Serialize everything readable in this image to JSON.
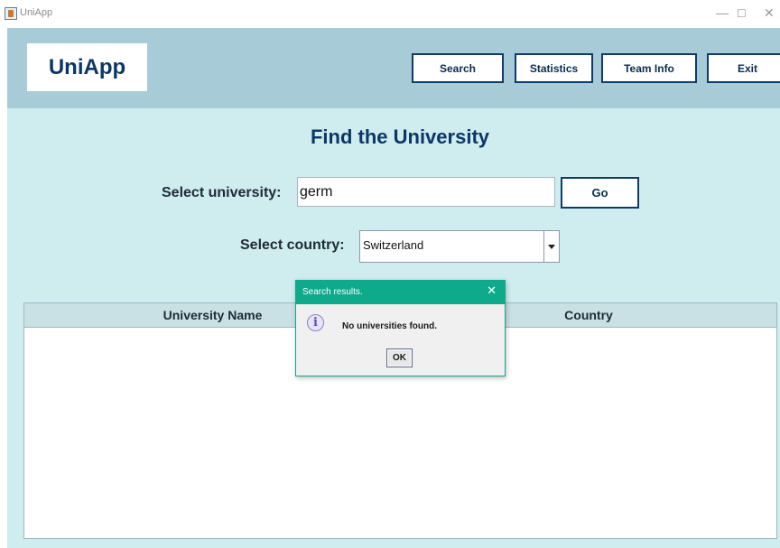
{
  "window": {
    "title": "UniApp"
  },
  "header": {
    "logo": "UniApp",
    "nav": {
      "search": "Search",
      "statistics": "Statistics",
      "team_info": "Team Info",
      "exit": "Exit"
    }
  },
  "main": {
    "title": "Find the University",
    "university_label": "Select university:",
    "university_value": "germ",
    "go_label": "Go",
    "country_label": "Select country:",
    "country_selected": "Switzerland"
  },
  "table": {
    "columns": [
      "University Name",
      "Country"
    ],
    "rows": []
  },
  "dialog": {
    "title": "Search results.",
    "message": "No universities found.",
    "ok_label": "OK",
    "icon": "info-icon"
  }
}
